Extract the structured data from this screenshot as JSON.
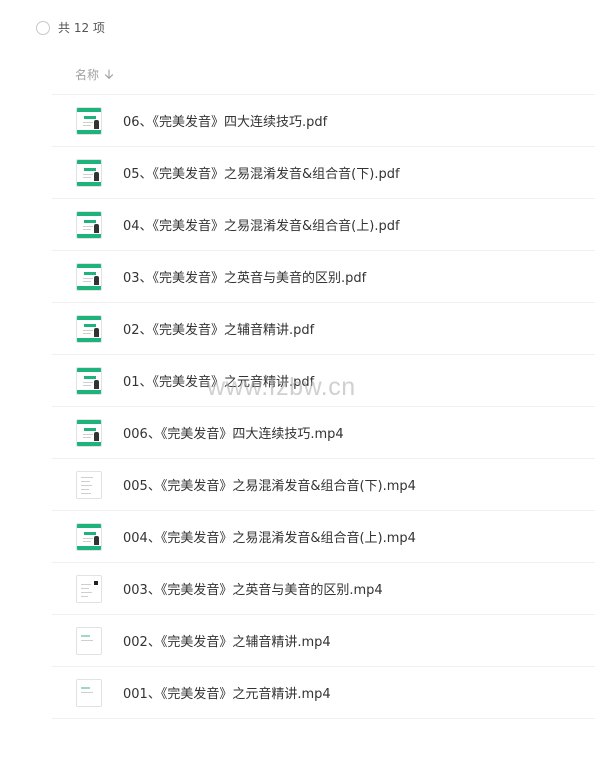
{
  "summary": {
    "count_label": "共 12 项"
  },
  "table": {
    "column_name_label": "名称",
    "sort_icon": "arrow-down-icon"
  },
  "files": [
    {
      "name": "06、《完美发音》四大连续技巧.pdf",
      "thumb": "green"
    },
    {
      "name": "05、《完美发音》之易混淆发音&组合音(下).pdf",
      "thumb": "green"
    },
    {
      "name": "04、《完美发音》之易混淆发音&组合音(上).pdf",
      "thumb": "green"
    },
    {
      "name": "03、《完美发音》之英音与美音的区别.pdf",
      "thumb": "green"
    },
    {
      "name": "02、《完美发音》之辅音精讲.pdf",
      "thumb": "green"
    },
    {
      "name": "01、《完美发音》之元音精讲.pdf",
      "thumb": "green"
    },
    {
      "name": "006、《完美发音》四大连续技巧.mp4",
      "thumb": "green"
    },
    {
      "name": "005、《完美发音》之易混淆发音&组合音(下).mp4",
      "thumb": "text"
    },
    {
      "name": "004、《完美发音》之易混淆发音&组合音(上).mp4",
      "thumb": "green"
    },
    {
      "name": "003、《完美发音》之英音与美音的区别.mp4",
      "thumb": "dark"
    },
    {
      "name": "002、《完美发音》之辅音精讲.mp4",
      "thumb": "light"
    },
    {
      "name": "001、《完美发音》之元音精讲.mp4",
      "thumb": "light"
    }
  ],
  "watermark": "www.fzbw.cn",
  "colors": {
    "accent": "#1db37a",
    "divider": "#f0f0f0",
    "text": "#333333",
    "muted": "#a0a0a0"
  }
}
